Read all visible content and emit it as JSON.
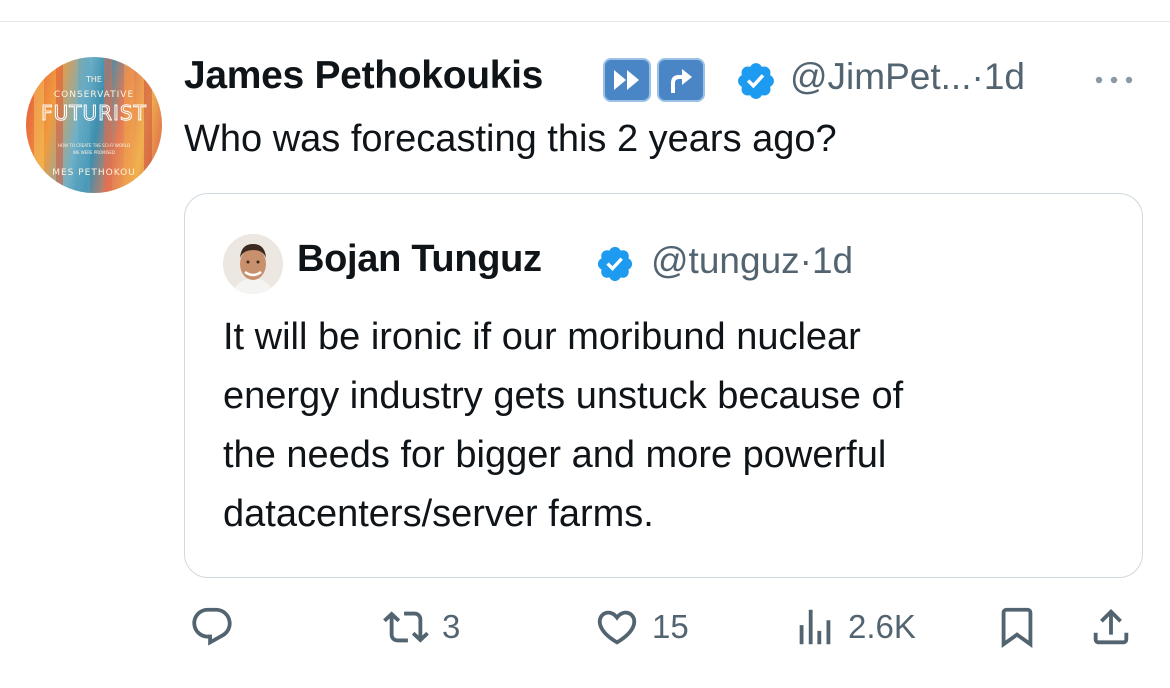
{
  "tweet": {
    "author_name": "James Pethokoukis",
    "badge_icons": [
      "fast-forward-icon",
      "arrow-up-right-icon"
    ],
    "verified_icon": "verified-badge-icon",
    "handle": "@JimPet...",
    "separator": "·",
    "time": "1d",
    "more_icon": "more-dots-icon",
    "text": "Who was forecasting this 2 years ago?",
    "avatar_book": {
      "line1": "THE",
      "line2": "CONSERVATIVE",
      "line3": "FUTURIST",
      "line4": "HOW TO CREATE THE SCI-FI WORLD",
      "line5": "WE WERE PROMISED",
      "line6": "MES PETHOKOU"
    }
  },
  "quoted": {
    "author_name": "Bojan Tunguz",
    "verified_icon": "verified-badge-icon",
    "handle": "@tunguz",
    "separator": "·",
    "time": "1d",
    "text_lines": [
      "It will be ironic if our moribund nuclear",
      "energy industry gets unstuck because of",
      "the needs for bigger and more powerful",
      "datacenters/server farms."
    ]
  },
  "actions": {
    "reply": {
      "icon": "reply-icon",
      "count": ""
    },
    "repost": {
      "icon": "repost-icon",
      "count": "3"
    },
    "like": {
      "icon": "heart-icon",
      "count": "15"
    },
    "views": {
      "icon": "views-icon",
      "count": "2.6K"
    },
    "bookmark": {
      "icon": "bookmark-icon"
    },
    "share": {
      "icon": "share-icon"
    }
  },
  "colors": {
    "text": "#0f1419",
    "secondary": "#536471",
    "verified": "#1d9bf0",
    "badge_blue": "#4a86c5",
    "border": "#cfd9de"
  }
}
